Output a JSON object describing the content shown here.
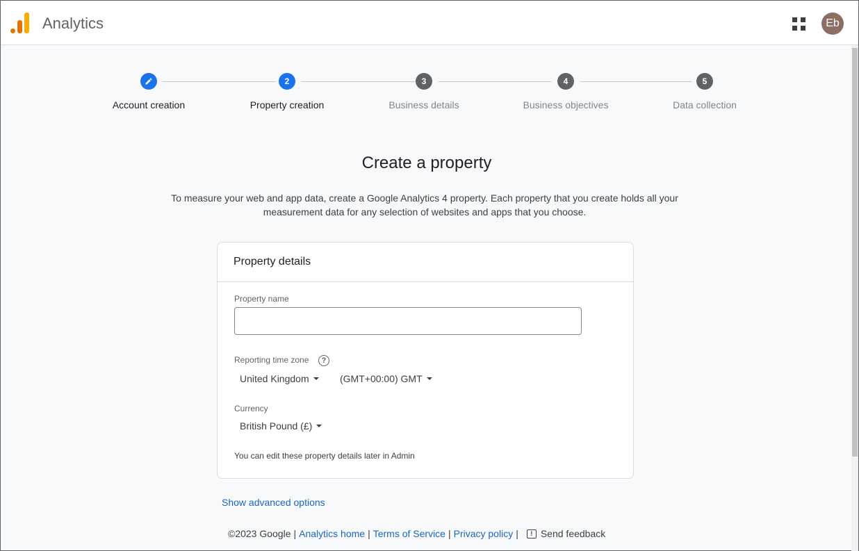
{
  "header": {
    "app_title": "Analytics",
    "avatar_initials": "Eb",
    "apps_icon": "apps-grid-icon"
  },
  "stepper": {
    "steps": [
      {
        "number": "",
        "label": "Account creation",
        "state": "done",
        "icon": "pencil-icon"
      },
      {
        "number": "2",
        "label": "Property creation",
        "state": "current"
      },
      {
        "number": "3",
        "label": "Business details",
        "state": "todo"
      },
      {
        "number": "4",
        "label": "Business objectives",
        "state": "todo"
      },
      {
        "number": "5",
        "label": "Data collection",
        "state": "todo"
      }
    ]
  },
  "main": {
    "title": "Create a property",
    "description_line1": "To measure your web and app data, create a Google Analytics 4 property. Each property that you create holds all your",
    "description_line2": "measurement data for any selection of websites and apps that you choose."
  },
  "card": {
    "header": "Property details",
    "property_name_label": "Property name",
    "property_name_value": "",
    "timezone_label": "Reporting time zone",
    "country_select": "United Kingdom",
    "timezone_select": "(GMT+00:00) GMT",
    "currency_label": "Currency",
    "currency_select": "British Pound (£)",
    "note": "You can edit these property details later in Admin"
  },
  "advanced_link": "Show advanced options",
  "footer": {
    "copyright": "©2023 Google",
    "analytics_home": "Analytics home",
    "terms": "Terms of Service",
    "privacy": "Privacy policy",
    "feedback": "Send feedback"
  },
  "colors": {
    "accent": "#1a73e8",
    "link": "#1a66c2",
    "logo_orange": "#e37400",
    "logo_yellow": "#f9ab00"
  }
}
